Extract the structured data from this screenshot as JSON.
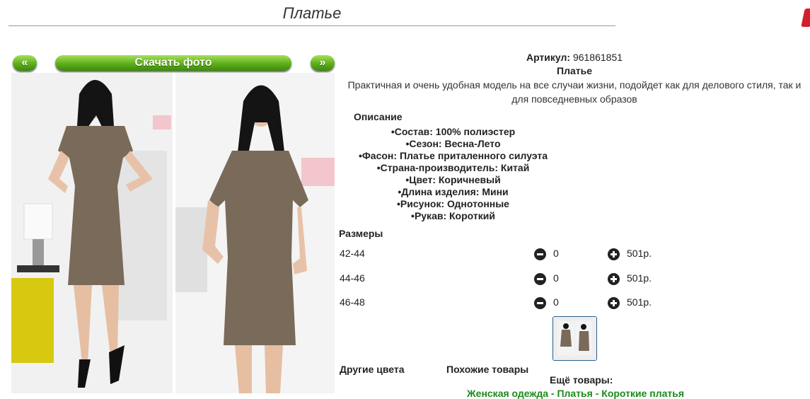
{
  "page": {
    "title": "Платье"
  },
  "gallery": {
    "prev_label": "«",
    "next_label": "»",
    "download_label": "Скачать фото"
  },
  "product": {
    "article_label": "Артикул:",
    "article_value": "961861851",
    "name": "Платье",
    "description": "Практичная и очень удобная модель на все случаи жизни, подойдет как для делового стиля, так и для повседневных образов",
    "desc_heading": "Описание",
    "properties": [
      "Состав: 100% полиэстер",
      "Сезон: Весна-Лето",
      "Фасон: Платье приталенного силуэта",
      "Страна-производитель: Китай",
      "Цвет: Коричневый",
      "Длина изделия: Мини",
      "Рисунок: Однотонные",
      "Рукав: Короткий"
    ]
  },
  "sizes": {
    "heading": "Размеры",
    "rows": [
      {
        "label": "42-44",
        "qty": "0",
        "price": "501р."
      },
      {
        "label": "44-46",
        "qty": "0",
        "price": "501р."
      },
      {
        "label": "46-48",
        "qty": "0",
        "price": "501р."
      }
    ]
  },
  "bottom": {
    "other_colors": "Другие цвета",
    "similar": "Похожие товары",
    "more": "Ещё товары:",
    "crumbs": [
      "Женская одежда",
      "Платья",
      "Короткие платья"
    ]
  },
  "colors": {
    "button_green": "#5fae1c",
    "dress_brown": "#7a6a5a",
    "link_green": "#1a8a1a",
    "corner_red": "#d21f2e"
  },
  "icons": {
    "corner": "red-x-icon",
    "minus": "minus-circle-icon",
    "plus": "plus-circle-icon"
  }
}
